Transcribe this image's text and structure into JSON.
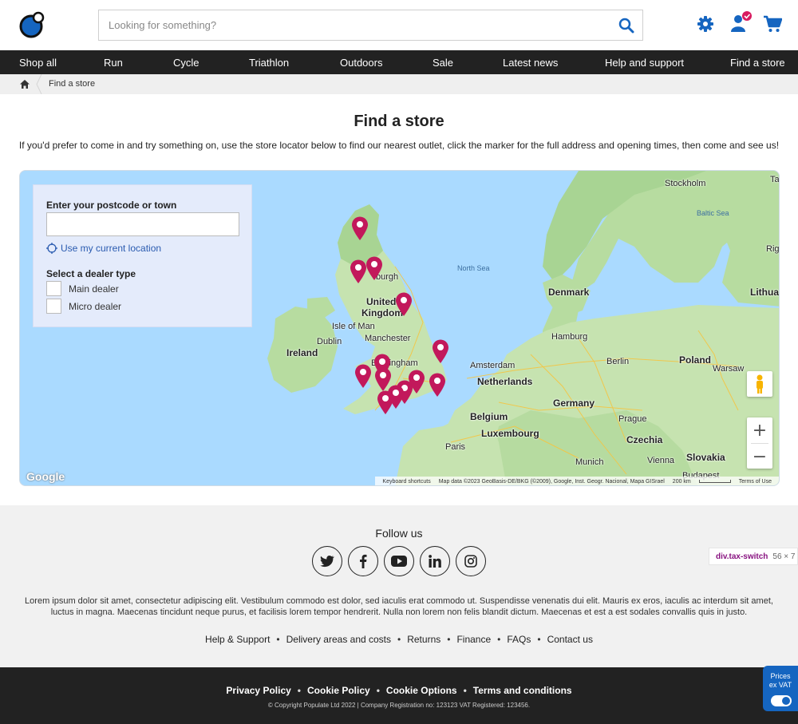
{
  "header": {
    "search_placeholder": "Looking for something?",
    "icons": [
      "logo-icon",
      "search-icon",
      "gear-icon",
      "user-icon",
      "cart-icon"
    ],
    "accent_color": "#1565c0",
    "badge_color": "#d81b60"
  },
  "nav": {
    "items": [
      "Shop all",
      "Run",
      "Cycle",
      "Triathlon",
      "Outdoors",
      "Sale",
      "Latest news",
      "Help and support",
      "Find a store"
    ]
  },
  "breadcrumb": {
    "current": "Find a store"
  },
  "main": {
    "title": "Find a store",
    "intro": "If you'd prefer to come in and try something on, use the store locator below to find our nearest outlet, click the marker for the full address and opening times, then come and see us!"
  },
  "locator": {
    "postcode_label": "Enter your postcode or town",
    "postcode_value": "",
    "location_link": "Use my current location",
    "dealer_type_label": "Select a dealer type",
    "dealer_types": [
      {
        "label": "Main dealer",
        "checked": false
      },
      {
        "label": "Micro dealer",
        "checked": false
      }
    ]
  },
  "map": {
    "labels": {
      "stockholm": "Stockholm",
      "baltic": "Baltic Sea",
      "ta": "Ta",
      "riga": "Rig",
      "north_sea": "North Sea",
      "denmark": "Denmark",
      "lithuania": "Lithua",
      "united": "United",
      "kingdom": "Kingdom",
      "isle_of_man": "Isle of Man",
      "dublin": "Dublin",
      "ireland": "Ireland",
      "manchester": "Manchester",
      "hamburg": "Hamburg",
      "birmingham": "Birmingham",
      "edinburgh": "burgh",
      "amsterdam": "Amsterdam",
      "berlin": "Berlin",
      "poland": "Poland",
      "warsaw": "Warsaw",
      "netherlands": "Netherlands",
      "germany": "Germany",
      "belgium": "Belgium",
      "luxembourg": "Luxembourg",
      "prague": "Prague",
      "czechia": "Czechia",
      "paris": "Paris",
      "munich": "Munich",
      "vienna": "Vienna",
      "slovakia": "Slovakia",
      "budapest": "Budapest"
    },
    "google": "Google",
    "attribution": {
      "shortcuts": "Keyboard shortcuts",
      "data": "Map data ©2023 GeoBasis-DE/BKG (©2009), Google, Inst. Geogr. Nacional, Mapa GISrael",
      "scale": "200 km",
      "terms": "Terms of Use"
    },
    "zoom_in": "+",
    "zoom_out": "−",
    "marker_color": "#c2185b"
  },
  "footer": {
    "follow": "Follow us",
    "socials": [
      "twitter-icon",
      "facebook-icon",
      "youtube-icon",
      "linkedin-icon",
      "instagram-icon"
    ],
    "lorem": "Lorem ipsum dolor sit amet, consectetur adipiscing elit. Vestibulum commodo est dolor, sed iaculis erat commodo ut. Suspendisse venenatis dui elit. Mauris ex eros, iaculis ac interdum sit amet, luctus in magna. Maecenas tincidunt neque purus, et facilisis lorem tempor hendrerit. Nulla non lorem non felis blandit dictum. Maecenas et est a est sodales convallis quis in justo.",
    "links": [
      "Help & Support",
      "Delivery areas and costs",
      "Returns",
      "Finance",
      "FAQs",
      "Contact us"
    ],
    "legal": [
      "Privacy Policy",
      "Cookie Policy",
      "Cookie Options",
      "Terms and conditions"
    ],
    "copyright": "© Copyright Populate Ltd 2022 | Company Registration no: 123123 VAT Registered: 123456."
  },
  "devtools_tag": {
    "selector": "div.tax-switch",
    "size": "56 × 7"
  },
  "vat_switch": {
    "line1": "Prices",
    "line2": "ex VAT",
    "on": true
  }
}
